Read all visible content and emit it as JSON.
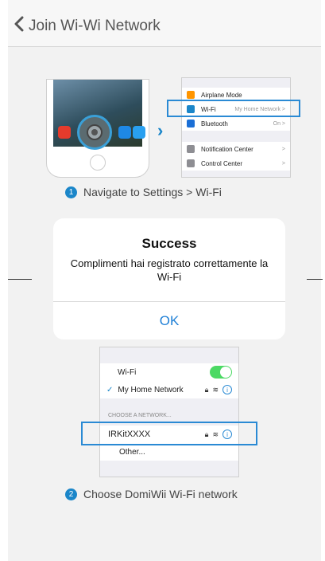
{
  "navbar": {
    "back_label": "Join Wi-Wi Network"
  },
  "step1": {
    "number": "1",
    "text": "Navigate to Settings > Wi-Fi",
    "settings_rows": [
      {
        "label": "Airplane Mode",
        "value": "",
        "color": "#ff9500"
      },
      {
        "label": "Wi-Fi",
        "value": "My Home Network >",
        "color": "#1b86c9"
      },
      {
        "label": "Bluetooth",
        "value": "On >",
        "color": "#1b6fd6"
      },
      {
        "label": "Notification Center",
        "value": ">",
        "color": "#8e8e93"
      },
      {
        "label": "Control Center",
        "value": ">",
        "color": "#8e8e93"
      }
    ]
  },
  "step2": {
    "number": "2",
    "text": "Choose DomiWii Wi-Fi network",
    "wifi_label": "Wi-Fi",
    "current_network": "My Home Network",
    "section_header": "CHOOSE A NETWORK...",
    "network": "IRKitXXXX",
    "other": "Other..."
  },
  "alert": {
    "title": "Success",
    "message": "Complimenti hai registrato correttamente la Wi-Fi",
    "ok_label": "OK"
  },
  "colors": {
    "accent": "#1e7fd6",
    "highlight": "#2a8ad4",
    "toggle_on": "#4cd964"
  }
}
